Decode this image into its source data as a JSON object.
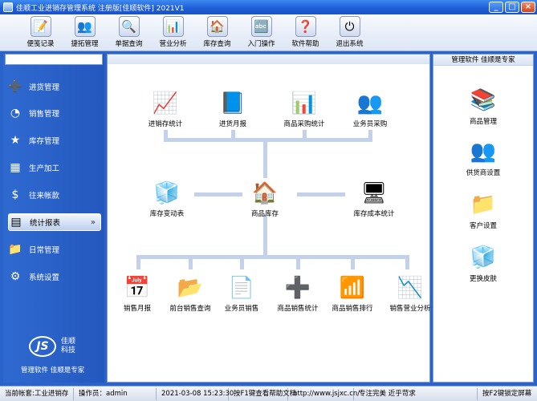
{
  "window": {
    "title": "佳顺工业进销存管理系统 注册版[佳顺软件] 2021V1",
    "min_label": "_",
    "max_label": "□",
    "close_label": "×"
  },
  "toolbar": {
    "items": [
      {
        "label": "便笺记录",
        "icon": "notepad-icon",
        "glyph": "📝"
      },
      {
        "label": "捷拓管理",
        "icon": "people-icon",
        "glyph": "👥"
      },
      {
        "label": "单据查询",
        "icon": "magnifier-icon",
        "glyph": "🔍"
      },
      {
        "label": "营业分析",
        "icon": "chart-icon",
        "glyph": "📊"
      },
      {
        "label": "库存查询",
        "icon": "house-icon",
        "glyph": "🏠"
      },
      {
        "label": "入门操作",
        "icon": "abc-icon",
        "glyph": "🔤"
      },
      {
        "label": "软件帮助",
        "icon": "help-icon",
        "glyph": "❓"
      },
      {
        "label": "退出系统",
        "icon": "power-icon",
        "glyph": "⏻"
      }
    ]
  },
  "sidebar": {
    "items": [
      {
        "label": "进货管理",
        "icon": "plus-icon",
        "glyph": "➕"
      },
      {
        "label": "销售管理",
        "icon": "pie-icon",
        "glyph": "◔"
      },
      {
        "label": "库存管理",
        "icon": "star-icon",
        "glyph": "★"
      },
      {
        "label": "生产加工",
        "icon": "blocks-icon",
        "glyph": "▦"
      },
      {
        "label": "往来帐款",
        "icon": "dollar-icon",
        "glyph": "$"
      },
      {
        "label": "统计报表",
        "icon": "report-icon",
        "glyph": "▤",
        "active": true,
        "arrow": "»"
      },
      {
        "label": "日常管理",
        "icon": "folder-icon",
        "glyph": "📁"
      },
      {
        "label": "系统设置",
        "icon": "gear-icon",
        "glyph": "⚙"
      }
    ],
    "logo_mark": "JS",
    "logo_name_line1": "佳顺",
    "logo_name_line2": "科技",
    "slogan": "管理软件 佳顺是专家"
  },
  "main": {
    "row1": [
      {
        "label": "进销存统计",
        "icon": "table-chart-icon",
        "glyph": "📈"
      },
      {
        "label": "进货月报",
        "icon": "monthly-report-icon",
        "glyph": "📘"
      },
      {
        "label": "商品采购统计",
        "icon": "purchase-stats-icon",
        "glyph": "📊"
      },
      {
        "label": "业务员采购",
        "icon": "salesman-icon",
        "glyph": "👥"
      }
    ],
    "row2": [
      {
        "label": "库存变动表",
        "icon": "inventory-change-icon",
        "glyph": "🧊"
      },
      {
        "label": "商品库存",
        "icon": "warehouse-icon",
        "glyph": "🏠"
      },
      {
        "label": "库存成本统计",
        "icon": "cost-stats-icon",
        "glyph": "🖥"
      }
    ],
    "row3": [
      {
        "label": "销售月报",
        "icon": "sales-monthly-icon",
        "glyph": "📅"
      },
      {
        "label": "前台销售查询",
        "icon": "binder-icon",
        "glyph": "📂"
      },
      {
        "label": "业务员销售",
        "icon": "salesman-sales-icon",
        "glyph": "📄"
      },
      {
        "label": "商品销售统计",
        "icon": "sales-stats-icon",
        "glyph": "➕"
      },
      {
        "label": "商品销售排行",
        "icon": "sales-rank-icon",
        "glyph": "📶"
      },
      {
        "label": "销售营业分析",
        "icon": "sales-analysis-icon",
        "glyph": "📉"
      }
    ]
  },
  "right": {
    "header": "管理软件 佳顺是专家",
    "items": [
      {
        "label": "商品管理",
        "icon": "books-icon",
        "glyph": "📚"
      },
      {
        "label": "供货商设置",
        "icon": "supplier-icon",
        "glyph": "👥"
      },
      {
        "label": "客户设置",
        "icon": "client-folder-icon",
        "glyph": "📁"
      },
      {
        "label": "更换皮肤",
        "icon": "skin-cube-icon",
        "glyph": "🧊"
      }
    ]
  },
  "status": {
    "account": "当前帐套:工业进销存",
    "operator": "操作员：admin",
    "datetime": "2021-03-08 15:23:30",
    "help": "按F1键查看帮助文档",
    "url": "http://www.jsjxc.cn/",
    "motto": "专注完美 近乎苛求",
    "lock": "按F2键锁定屏幕"
  }
}
